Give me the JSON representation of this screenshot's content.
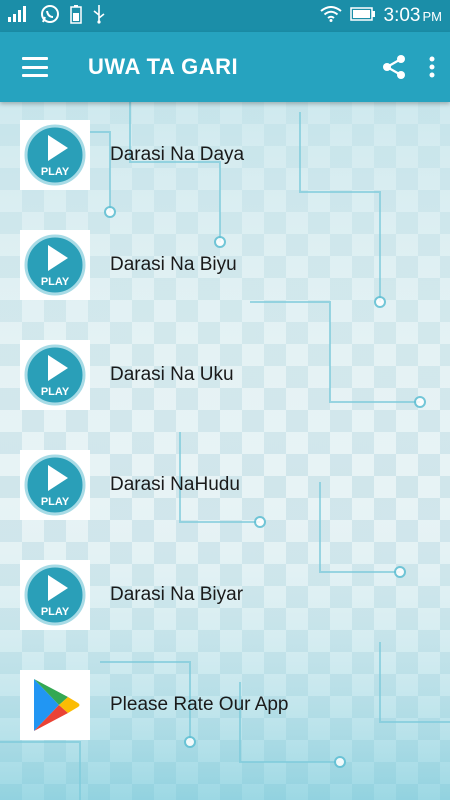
{
  "status_bar": {
    "time": "3:03",
    "ampm": "PM",
    "icons": [
      "signal-icon",
      "whatsapp-icon",
      "battery-saver-icon",
      "usb-icon",
      "wifi-icon",
      "battery-icon"
    ]
  },
  "app_bar": {
    "title": "UWA TA GARI",
    "menu_icon": "hamburger-menu-icon",
    "share_icon": "share-icon",
    "overflow_icon": "more-vert-icon"
  },
  "list": {
    "items": [
      {
        "label": "Darasi Na Daya",
        "icon": "play-icon"
      },
      {
        "label": "Darasi Na Biyu",
        "icon": "play-icon"
      },
      {
        "label": "Darasi Na Uku",
        "icon": "play-icon"
      },
      {
        "label": "Darasi NaHudu",
        "icon": "play-icon"
      },
      {
        "label": "Darasi Na Biyar",
        "icon": "play-icon"
      },
      {
        "label": "Please Rate Our App",
        "icon": "google-play-icon"
      }
    ],
    "play_text": "PLAY"
  },
  "colors": {
    "status_bar": "#1b8ea8",
    "app_bar": "#26a3bf",
    "play_badge": "#2a9fb8"
  }
}
